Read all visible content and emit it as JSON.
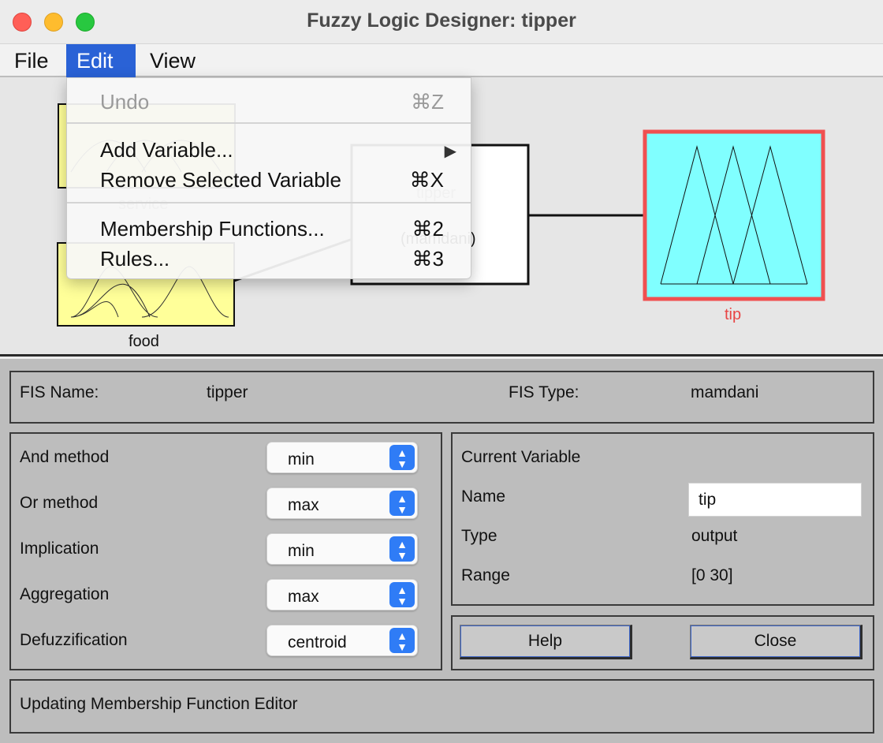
{
  "window": {
    "title": "Fuzzy Logic Designer: tipper"
  },
  "menubar": {
    "file": "File",
    "edit": "Edit",
    "view": "View"
  },
  "edit_menu": {
    "undo": {
      "label": "Undo",
      "shortcut": "⌘Z"
    },
    "add_variable": {
      "label": "Add Variable..."
    },
    "remove_variable": {
      "label": "Remove Selected Variable",
      "shortcut": "⌘X"
    },
    "membership_functions": {
      "label": "Membership Functions...",
      "shortcut": "⌘2"
    },
    "rules": {
      "label": "Rules...",
      "shortcut": "⌘3"
    }
  },
  "diagram": {
    "inputs": [
      "service",
      "food"
    ],
    "system_name": "tipper",
    "system_type": "(mamdani)",
    "output": "tip",
    "colors": {
      "input_fill": "#ffff99",
      "output_fill": "#80ffff",
      "selected_border": "#f05050"
    }
  },
  "fis": {
    "name_label": "FIS Name:",
    "name_value": "tipper",
    "type_label": "FIS Type:",
    "type_value": "mamdani"
  },
  "methods": [
    {
      "label": "And method",
      "value": "min"
    },
    {
      "label": "Or method",
      "value": "max"
    },
    {
      "label": "Implication",
      "value": "min"
    },
    {
      "label": "Aggregation",
      "value": "max"
    },
    {
      "label": "Defuzzification",
      "value": "centroid"
    }
  ],
  "current_variable": {
    "heading": "Current Variable",
    "name_label": "Name",
    "name_value": "tip",
    "type_label": "Type",
    "type_value": "output",
    "range_label": "Range",
    "range_value": "[0 30]"
  },
  "buttons": {
    "help": "Help",
    "close": "Close"
  },
  "status": {
    "text": "Updating Membership Function Editor"
  }
}
